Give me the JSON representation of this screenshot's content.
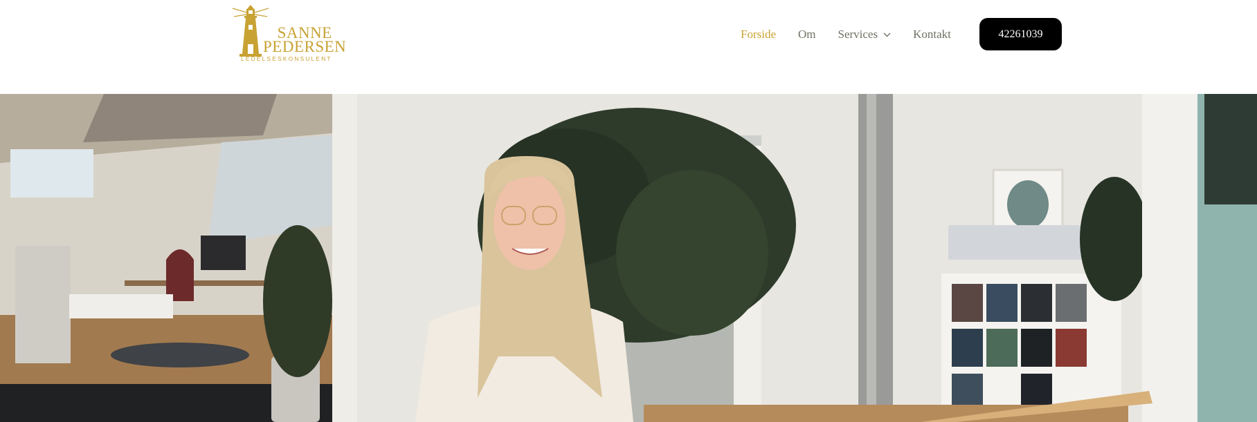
{
  "brand": {
    "name_line1": "SANNE",
    "name_line2": "PEDERSEN",
    "tagline": "LEDELSESKONSULENT",
    "color": "#c8a233",
    "icon": "lighthouse-icon"
  },
  "nav": {
    "items": [
      {
        "label": "Forside",
        "active": true
      },
      {
        "label": "Om",
        "active": false
      },
      {
        "label": "Services",
        "active": false,
        "has_dropdown": true
      },
      {
        "label": "Kontakt",
        "active": false
      }
    ],
    "text_color": "#6d7263",
    "active_color": "#c8a233"
  },
  "cta": {
    "phone_label": "42261039",
    "bg_color": "#000000"
  },
  "hero": {
    "icon": "hero-photo"
  }
}
